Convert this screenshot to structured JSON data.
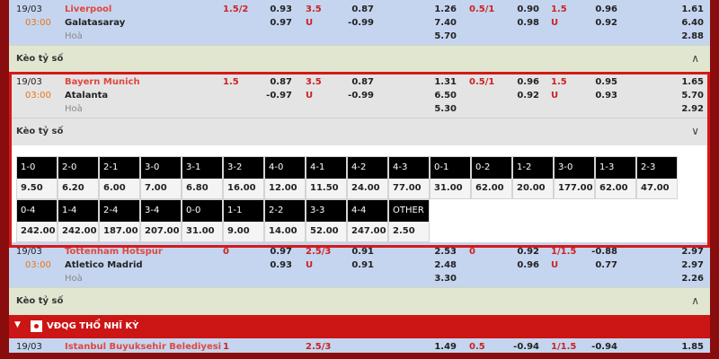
{
  "matches": [
    {
      "date": "19/03",
      "time": "03:00",
      "home": "Liverpool",
      "away": "Galatasaray",
      "draw": "Hoà",
      "hdp_line": "1.5/2",
      "hdp_home": "0.93",
      "hdp_away": "0.97",
      "ou_line": "3.5",
      "ou_over": "0.87",
      "ou_u": "U",
      "ou_under": "-0.99",
      "x12_home": "1.26",
      "x12_away": "7.40",
      "x12_draw": "5.70",
      "h1_hdp_line": "0.5/1",
      "h1_hdp_home": "0.90",
      "h1_hdp_away": "0.98",
      "h1_ou_line": "1.5",
      "h1_ou_over": "0.96",
      "h1_ou_u": "U",
      "h1_ou_under": "0.92",
      "h1_x12_home": "1.61",
      "h1_x12_away": "6.40",
      "h1_x12_draw": "2.88"
    },
    {
      "date": "19/03",
      "time": "03:00",
      "home": "Bayern Munich",
      "away": "Atalanta",
      "draw": "Hoà",
      "hdp_line": "1.5",
      "hdp_home": "0.87",
      "hdp_away": "-0.97",
      "ou_line": "3.5",
      "ou_over": "0.87",
      "ou_u": "U",
      "ou_under": "-0.99",
      "x12_home": "1.31",
      "x12_away": "6.50",
      "x12_draw": "5.30",
      "h1_hdp_line": "0.5/1",
      "h1_hdp_home": "0.96",
      "h1_hdp_away": "0.92",
      "h1_ou_line": "1.5",
      "h1_ou_over": "0.95",
      "h1_ou_u": "U",
      "h1_ou_under": "0.93",
      "h1_x12_home": "1.65",
      "h1_x12_away": "5.70",
      "h1_x12_draw": "2.92"
    },
    {
      "date": "19/03",
      "time": "03:00",
      "home": "Tottenham Hotspur",
      "away": "Atletico Madrid",
      "draw": "Hoà",
      "hdp_line": "0",
      "hdp_home": "0.97",
      "hdp_away": "0.93",
      "ou_line": "2.5/3",
      "ou_over": "0.91",
      "ou_u": "U",
      "ou_under": "0.91",
      "x12_home": "2.53",
      "x12_away": "2.48",
      "x12_draw": "3.30",
      "h1_hdp_line": "0",
      "h1_hdp_home": "0.92",
      "h1_hdp_away": "0.96",
      "h1_ou_line": "1/1.5",
      "h1_ou_over": "-0.88",
      "h1_ou_u": "U",
      "h1_ou_under": "0.77",
      "h1_x12_home": "2.97",
      "h1_x12_away": "2.97",
      "h1_x12_draw": "2.26"
    }
  ],
  "keo_label": "Kèo tỷ số",
  "icons": {
    "collapsed": "chevron-up-icon",
    "expanded": "chevron-down-icon"
  },
  "icon_glyphs": {
    "up": "∧",
    "down": "∨"
  },
  "score_rows": [
    [
      [
        "1-0",
        "9.50"
      ],
      [
        "2-0",
        "6.20"
      ],
      [
        "2-1",
        "6.00"
      ],
      [
        "3-0",
        "7.00"
      ],
      [
        "3-1",
        "6.80"
      ],
      [
        "3-2",
        "16.00"
      ],
      [
        "4-0",
        "12.00"
      ],
      [
        "4-1",
        "11.50"
      ],
      [
        "4-2",
        "24.00"
      ],
      [
        "4-3",
        "77.00"
      ],
      [
        "0-1",
        "31.00"
      ],
      [
        "0-2",
        "62.00"
      ],
      [
        "1-2",
        "20.00"
      ],
      [
        "3-0",
        "177.00"
      ],
      [
        "1-3",
        "62.00"
      ],
      [
        "2-3",
        "47.00"
      ]
    ],
    [
      [
        "0-4",
        "242.00"
      ],
      [
        "1-4",
        "242.00"
      ],
      [
        "2-4",
        "187.00"
      ],
      [
        "3-4",
        "207.00"
      ],
      [
        "0-0",
        "31.00"
      ],
      [
        "1-1",
        "9.00"
      ],
      [
        "2-2",
        "14.00"
      ],
      [
        "3-3",
        "52.00"
      ],
      [
        "4-4",
        "247.00"
      ],
      [
        "OTHER",
        "2.50"
      ]
    ]
  ],
  "league": {
    "name": "VĐQG THỔ NHĨ KỲ",
    "arrow": "▼"
  },
  "partial_match": {
    "date": "19/03",
    "home": "Istanbul Buyuksehir Belediyesi",
    "hdp_line": "1",
    "ou_line": "2.5/3",
    "x12_home": "1.49",
    "h1_hdp_line": "0.5",
    "h1_hdp_home": "-0.94",
    "h1_ou_line": "1/1.5",
    "h1_ou_over": "-0.94",
    "h1_x12_home": "1.85"
  },
  "colors": {
    "highlight_border": "#d41a1a",
    "league_bar": "#cc1515",
    "time": "#e8751a",
    "home_team": "#e0473e"
  }
}
